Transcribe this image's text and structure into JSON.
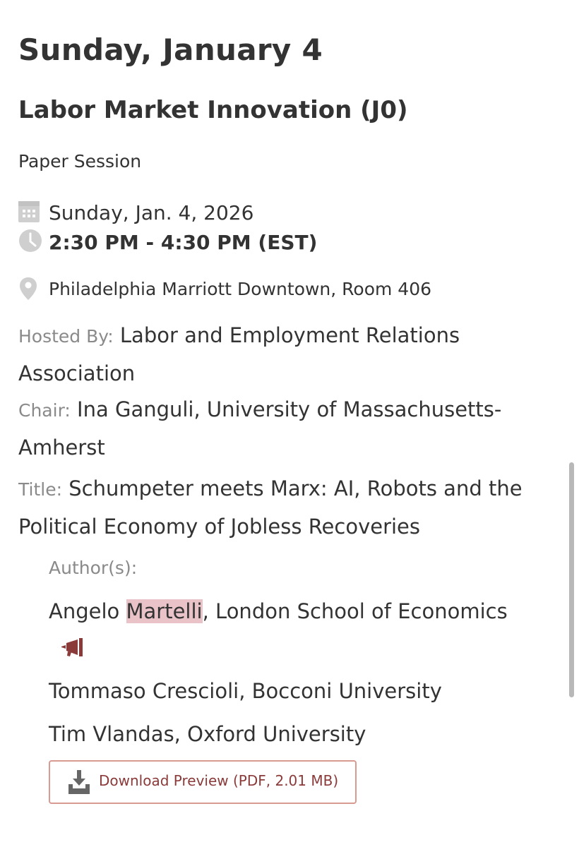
{
  "header": {
    "day_heading": "Sunday, January 4"
  },
  "session": {
    "title": "Labor Market Innovation (J0)",
    "type": "Paper Session",
    "date": "Sunday, Jan. 4, 2026",
    "time": "2:30 PM - 4:30 PM (EST)",
    "location": "Philadelphia Marriott Downtown, Room 406",
    "hosted_by_label": "Hosted By:",
    "hosted_by": "Labor and Employment Relations Association",
    "chair_label": "Chair:",
    "chair": "Ina Ganguli, University of Massachusetts-Amherst"
  },
  "paper": {
    "title_label": "Title:",
    "title": "Schumpeter meets Marx: AI, Robots and the Political Economy of Jobless Recoveries",
    "authors_label": "Author(s):",
    "authors": [
      {
        "first_name": "Angelo",
        "last_name": "Martelli",
        "affiliation_suffix": ", London School of Economics",
        "presenter_icon": "megaphone-icon"
      },
      {
        "full": "Tommaso Crescioli, Bocconi University"
      },
      {
        "full": "Tim Vlandas, Oxford University"
      }
    ]
  },
  "download": {
    "label": "Download Preview (PDF, 2.01 MB)",
    "icon": "download-tray-icon"
  },
  "icons": {
    "calendar": "calendar-icon",
    "clock": "clock-icon",
    "location": "location-pin-icon"
  },
  "colors": {
    "text": "#333333",
    "label_gray": "#8a8a8a",
    "icon_gray": "#cfcfcf",
    "accent_red": "#8b3a3a",
    "button_border": "#d99a91",
    "highlight": "#e9c3c8"
  }
}
